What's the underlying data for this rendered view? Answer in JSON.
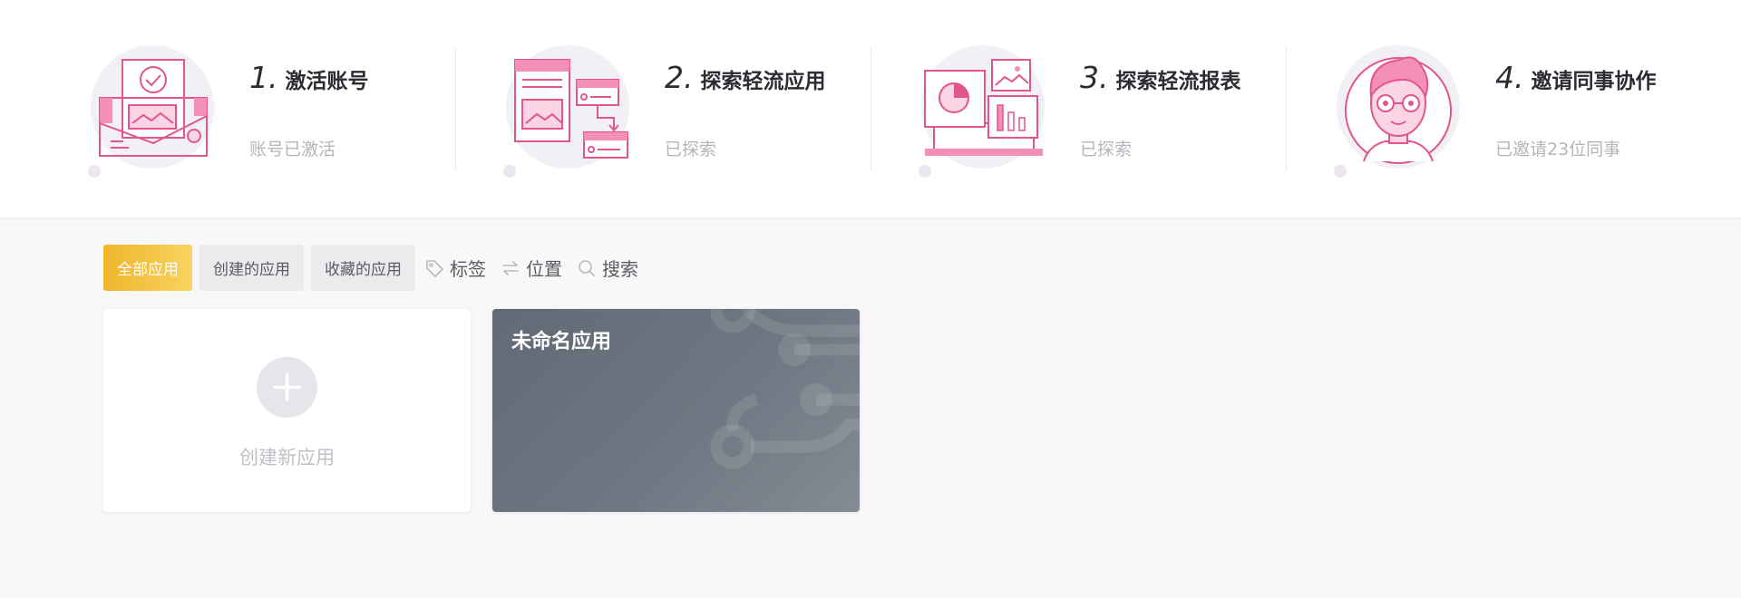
{
  "steps": [
    {
      "number": "1.",
      "title": "激活账号",
      "status": "账号已激活",
      "icon": "activate-account-illustration"
    },
    {
      "number": "2.",
      "title": "探索轻流应用",
      "status": "已探索",
      "icon": "explore-app-illustration"
    },
    {
      "number": "3.",
      "title": "探索轻流报表",
      "status": "已探索",
      "icon": "explore-report-illustration"
    },
    {
      "number": "4.",
      "title": "邀请同事协作",
      "status": "已邀请23位同事",
      "icon": "invite-colleagues-illustration"
    }
  ],
  "filters": {
    "tabs": [
      "全部应用",
      "创建的应用",
      "收藏的应用"
    ],
    "active_tab": "全部应用",
    "tools": [
      {
        "label": "标签",
        "icon": "tag-icon"
      },
      {
        "label": "位置",
        "icon": "swap-arrows-icon"
      },
      {
        "label": "搜索",
        "icon": "search-icon"
      }
    ]
  },
  "cards": {
    "create_label": "创建新应用",
    "apps": [
      {
        "name": "未命名应用"
      }
    ]
  },
  "colors": {
    "accent": "#f2bd3a",
    "illustration_pink": "#e0568d",
    "app_card": "#6b737e"
  }
}
